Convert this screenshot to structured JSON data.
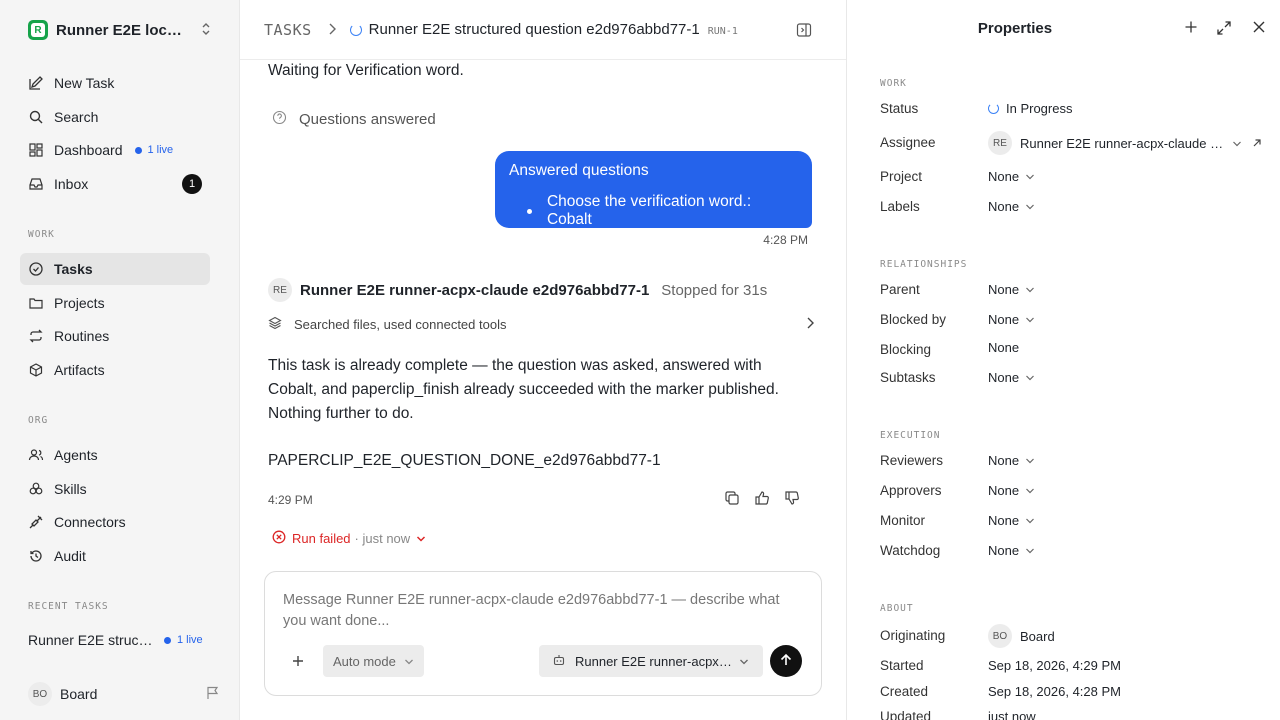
{
  "sidebar": {
    "workspace_name": "Runner E2E local...",
    "workspace_logo": "R",
    "nav": {
      "new_task": "New Task",
      "search": "Search",
      "dashboard": "Dashboard",
      "dashboard_live": "1 live",
      "inbox": "Inbox",
      "inbox_count": "1"
    },
    "work_label": "WORK",
    "work_items": {
      "tasks": "Tasks",
      "projects": "Projects",
      "routines": "Routines",
      "artifacts": "Artifacts"
    },
    "org_label": "ORG",
    "org_items": {
      "agents": "Agents",
      "skills": "Skills",
      "connectors": "Connectors",
      "audit": "Audit"
    },
    "recent_label": "RECENT TASKS",
    "recent_task": "Runner E2E struct...",
    "recent_live": "1 live",
    "user_initials": "BO",
    "user_name": "Board"
  },
  "header": {
    "crumb_root": "TASKS",
    "title": "Runner E2E structured question e2d976abbd77-1",
    "run_id": "RUN-1"
  },
  "thread": {
    "waiting_text": "Waiting for Verification word.",
    "questions_answered": "Questions answered",
    "bubble_title": "Answered questions",
    "bubble_item": "Choose the verification word.: Cobalt",
    "bubble_time": "4:28 PM",
    "agent_initials": "RE",
    "agent_name": "Runner E2E runner-acpx-claude e2d976abbd77-1",
    "agent_status": "Stopped for 31s",
    "tools_summary": "Searched files, used connected tools",
    "reply_text": "This task is already complete — the question was asked, answered with Cobalt, and paperclip_finish already succeeded with the marker published. Nothing further to do.",
    "marker": "PAPERCLIP_E2E_QUESTION_DONE_e2d976abbd77-1",
    "reply_time": "4:29 PM",
    "run_failed": "Run failed",
    "run_when": "· just now"
  },
  "composer": {
    "placeholder": "Message Runner E2E runner-acpx-claude e2d976abbd77-1 — describe what you want done...",
    "mode": "Auto mode",
    "agent": "Runner E2E runner-acpx-..."
  },
  "properties": {
    "title": "Properties",
    "work_label": "WORK",
    "status_label": "Status",
    "status_value": "In Progress",
    "assignee_label": "Assignee",
    "assignee_initials": "RE",
    "assignee_value": "Runner E2E runner-acpx-claude e...",
    "project_label": "Project",
    "project_value": "None",
    "labels_label": "Labels",
    "labels_value": "None",
    "relationships_label": "RELATIONSHIPS",
    "parent_label": "Parent",
    "parent_value": "None",
    "blocked_by_label": "Blocked by",
    "blocked_by_value": "None",
    "blocking_label": "Blocking",
    "blocking_value": "None",
    "subtasks_label": "Subtasks",
    "subtasks_value": "None",
    "execution_label": "EXECUTION",
    "reviewers_label": "Reviewers",
    "reviewers_value": "None",
    "approvers_label": "Approvers",
    "approvers_value": "None",
    "monitor_label": "Monitor",
    "monitor_value": "None",
    "watchdog_label": "Watchdog",
    "watchdog_value": "None",
    "about_label": "ABOUT",
    "originating_label": "Originating",
    "originating_initials": "BO",
    "originating_value": "Board",
    "started_label": "Started",
    "started_value": "Sep 18, 2026, 4:29 PM",
    "created_label": "Created",
    "created_value": "Sep 18, 2026, 4:28 PM",
    "updated_label": "Updated",
    "updated_value": "just now"
  },
  "colors": {
    "accent": "#2563eb",
    "danger": "#dc2626",
    "brand": "#16a34a"
  }
}
